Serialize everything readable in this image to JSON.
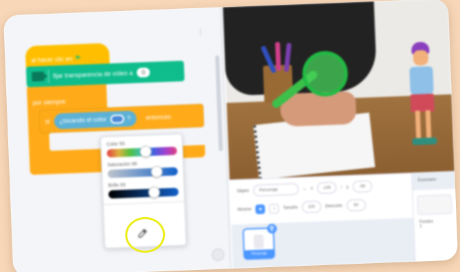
{
  "code_area": {
    "hat_label": "al hacer clic en",
    "ext_block_label": "fijar transparencia de vídeo a",
    "ext_block_value": "0",
    "forever_label": "por siempre",
    "if_prefix": "si",
    "sensing_label": "¿tocando el color",
    "sensing_suffix": "?",
    "then_label": "entonces",
    "sensing_color": "#4a8ad8"
  },
  "color_picker": {
    "color_label": "Color",
    "color_value": "55",
    "saturation_label": "Saturación",
    "saturation_value": "96",
    "brightness_label": "Brillo",
    "brightness_value": "93",
    "hue_level": 0.55,
    "saturation_level": 0.7,
    "brightness_level": 0.65,
    "eyedropper_icon": "eyedropper-icon"
  },
  "sprite_info": {
    "sprite_label": "Objeto",
    "sprite_name": "Personaje",
    "x_label": "x",
    "x_value": "-148",
    "y_label": "y",
    "y_value": "-99",
    "show_label": "Mostrar",
    "size_label": "Tamaño",
    "size_value": "100",
    "direction_label": "Dirección",
    "direction_value": "90"
  },
  "sprite_list": {
    "tile_name": "Personaje"
  },
  "stage_panel": {
    "header": "Escenario",
    "backdrops_label": "Fondos",
    "backdrops_count": "1"
  }
}
